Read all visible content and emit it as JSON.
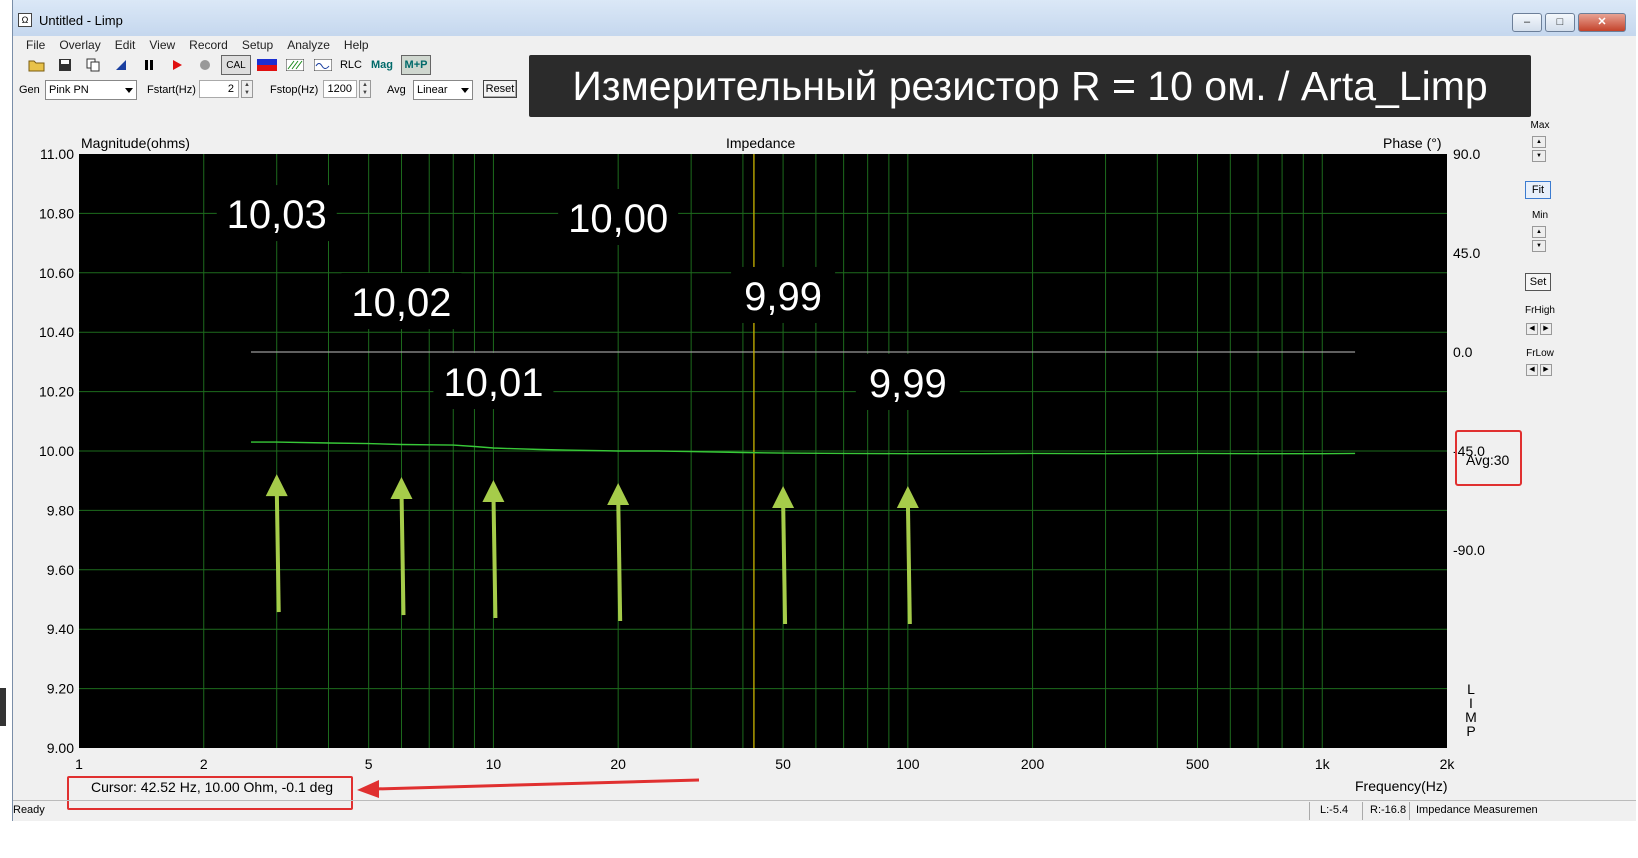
{
  "window": {
    "title": "Untitled - Limp",
    "icon_glyph": "Ω"
  },
  "menu": [
    "File",
    "Overlay",
    "Edit",
    "View",
    "Record",
    "Setup",
    "Analyze",
    "Help"
  ],
  "toolbar": {
    "cal_label": "CAL",
    "rlc_label": "RLC",
    "mag_label": "Mag",
    "mp_label": "M+P"
  },
  "controls": {
    "gen_label": "Gen",
    "gen_value": "Pink PN",
    "fstart_label": "Fstart(Hz)",
    "fstart_value": "2",
    "fstop_label": "Fstop(Hz)",
    "fstop_value": "1200",
    "avg_label": "Avg",
    "avg_value": "Linear",
    "reset_label": "Reset"
  },
  "overlay_title": "Измерительный резистор R = 10 ом. / Arta_Limp",
  "right_panel": {
    "max_label": "Max",
    "fit_label": "Fit",
    "min_label": "Min",
    "set_label": "Set",
    "frhigh_label": "FrHigh",
    "frlow_label": "FrLow"
  },
  "chart_data": {
    "type": "line",
    "title": "Impedance",
    "ylabel": "Magnitude(ohms)",
    "y2label": "Phase (°)",
    "xlabel": "Frequency(Hz)",
    "xscale": "log",
    "xlim": [
      1,
      2000
    ],
    "ylim": [
      9.0,
      11.0
    ],
    "y2lim": [
      -180,
      90
    ],
    "x_ticks": [
      "1",
      "2",
      "5",
      "10",
      "20",
      "50",
      "100",
      "200",
      "500",
      "1k",
      "2k"
    ],
    "x_tick_values": [
      1,
      2,
      5,
      10,
      20,
      50,
      100,
      200,
      500,
      1000,
      2000
    ],
    "y_ticks": [
      "11.00",
      "10.80",
      "10.60",
      "10.40",
      "10.20",
      "10.00",
      "9.80",
      "9.60",
      "9.40",
      "9.20",
      "9.00"
    ],
    "y2_ticks": [
      "90.0",
      "45.0",
      "0.0",
      "-45.0",
      "-90.0"
    ],
    "series": [
      {
        "color": "#38c838",
        "x": [
          2.6,
          3,
          4,
          5,
          6,
          7,
          8,
          9,
          10,
          11,
          13,
          15,
          20,
          25,
          30,
          40,
          50,
          70,
          100,
          150,
          200,
          300,
          500,
          700,
          1000,
          1200
        ],
        "y": [
          10.03,
          10.03,
          10.027,
          10.025,
          10.022,
          10.021,
          10.02,
          10.015,
          10.01,
          10.008,
          10.005,
          10.003,
          10.0,
          10.0,
          9.998,
          9.995,
          9.993,
          9.992,
          9.991,
          9.991,
          9.992,
          9.991,
          9.992,
          9.991,
          9.991,
          9.992
        ]
      },
      {
        "color": "#9a9a9a",
        "x": [
          2.6,
          1200
        ],
        "y2": [
          0.0,
          0.0
        ]
      }
    ],
    "cursor_x": 42.52,
    "grid": true,
    "annotations": [
      {
        "text": "10,03",
        "x": 3,
        "y": 10.03
      },
      {
        "text": "10,02",
        "x": 6,
        "y": 10.02
      },
      {
        "text": "10,01",
        "x": 10,
        "y": 10.01
      },
      {
        "text": "10,00",
        "x": 20,
        "y": 10.0
      },
      {
        "text": "9,99",
        "x": 50,
        "y": 9.99
      },
      {
        "text": "9,99",
        "x": 100,
        "y": 9.99
      }
    ]
  },
  "avg_readout": "Avg:30",
  "cursor_readout": "Cursor: 42.52 Hz, 10.00 Ohm, -0.1 deg",
  "limp_vertical": [
    "L",
    "I",
    "M",
    "P"
  ],
  "status": {
    "left": "Ready",
    "l_level": "L:-5.4",
    "r_level": "R:-16.8",
    "mode": "Impedance Measuremen"
  },
  "colors": {
    "trace": "#38c838",
    "grid": "#1d6b1d",
    "cursor": "#c8b400",
    "arrow": "#a6cc4a",
    "highlight_box": "#e03030"
  }
}
